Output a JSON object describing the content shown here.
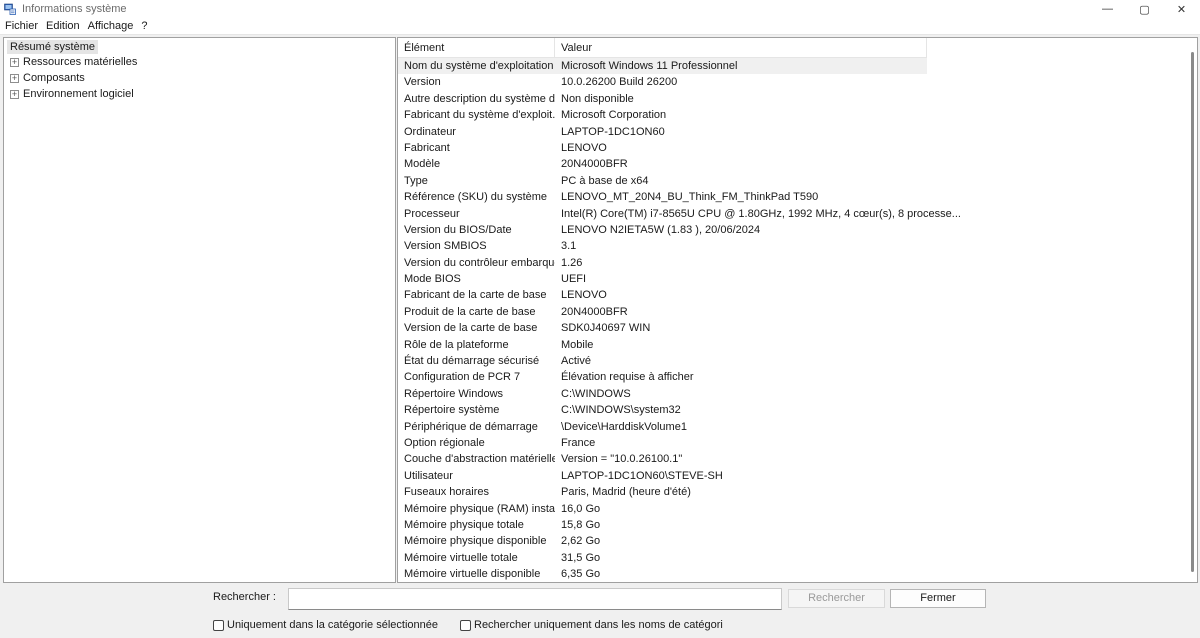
{
  "window": {
    "title": "Informations système",
    "controls": {
      "minimize": "—",
      "maximize": "▢",
      "close": "✕"
    }
  },
  "menu": [
    "Fichier",
    "Edition",
    "Affichage",
    "?"
  ],
  "tree": {
    "root": "Résumé système",
    "children": [
      {
        "label": "Ressources matérielles",
        "expander": "+"
      },
      {
        "label": "Composants",
        "expander": "+"
      },
      {
        "label": "Environnement logiciel",
        "expander": "+"
      }
    ]
  },
  "list": {
    "headers": [
      "Élément",
      "Valeur"
    ],
    "rows": [
      [
        "Nom du système d'exploitation",
        "Microsoft Windows 11 Professionnel"
      ],
      [
        "Version",
        "10.0.26200 Build 26200"
      ],
      [
        "Autre description du système d...",
        "Non disponible"
      ],
      [
        "Fabricant du système d'exploit...",
        "Microsoft Corporation"
      ],
      [
        "Ordinateur",
        "LAPTOP-1DC1ON60"
      ],
      [
        "Fabricant",
        "LENOVO"
      ],
      [
        "Modèle",
        "20N4000BFR"
      ],
      [
        "Type",
        "PC à base de x64"
      ],
      [
        "Référence (SKU) du système",
        "LENOVO_MT_20N4_BU_Think_FM_ThinkPad T590"
      ],
      [
        "Processeur",
        "Intel(R) Core(TM) i7-8565U CPU @ 1.80GHz, 1992 MHz, 4 cœur(s), 8 processe..."
      ],
      [
        "Version du BIOS/Date",
        "LENOVO N2IETA5W (1.83 ), 20/06/2024"
      ],
      [
        "Version SMBIOS",
        "3.1"
      ],
      [
        "Version du contrôleur embarqué",
        "1.26"
      ],
      [
        "Mode BIOS",
        "UEFI"
      ],
      [
        "Fabricant de la carte de base",
        "LENOVO"
      ],
      [
        "Produit de la carte de base",
        "20N4000BFR"
      ],
      [
        "Version de la carte de base",
        "SDK0J40697 WIN"
      ],
      [
        "Rôle de la plateforme",
        "Mobile"
      ],
      [
        "État du démarrage sécurisé",
        "Activé"
      ],
      [
        "Configuration de PCR 7",
        "Élévation requise à afficher"
      ],
      [
        "Répertoire Windows",
        "C:\\WINDOWS"
      ],
      [
        "Répertoire système",
        "C:\\WINDOWS\\system32"
      ],
      [
        "Périphérique de démarrage",
        "\\Device\\HarddiskVolume1"
      ],
      [
        "Option régionale",
        "France"
      ],
      [
        "Couche d'abstraction matérielle",
        "Version = \"10.0.26100.1\""
      ],
      [
        "Utilisateur",
        "LAPTOP-1DC1ON60\\STEVE-SH"
      ],
      [
        "Fuseaux horaires",
        "Paris, Madrid (heure d'été)"
      ],
      [
        "Mémoire physique (RAM) instal...",
        "16,0 Go"
      ],
      [
        "Mémoire physique totale",
        "15,8 Go"
      ],
      [
        "Mémoire physique disponible",
        "2,62 Go"
      ],
      [
        "Mémoire virtuelle totale",
        "31,5 Go"
      ],
      [
        "Mémoire virtuelle disponible",
        "6,35 Go"
      ]
    ]
  },
  "search": {
    "label": "Rechercher :",
    "value": "",
    "search_button": "Rechercher",
    "close_button": "Fermer",
    "option_selected_category": "Uniquement dans la catégorie sélectionnée",
    "option_category_names": "Rechercher uniquement dans les noms de catégori"
  },
  "colors": {
    "background": "#f0f0f0",
    "pane": "#ffffff",
    "selected_row": "#f0f0f0",
    "tree_root_highlight": "#e5e5e5",
    "app_icon_blue": "#2b5fb3"
  }
}
